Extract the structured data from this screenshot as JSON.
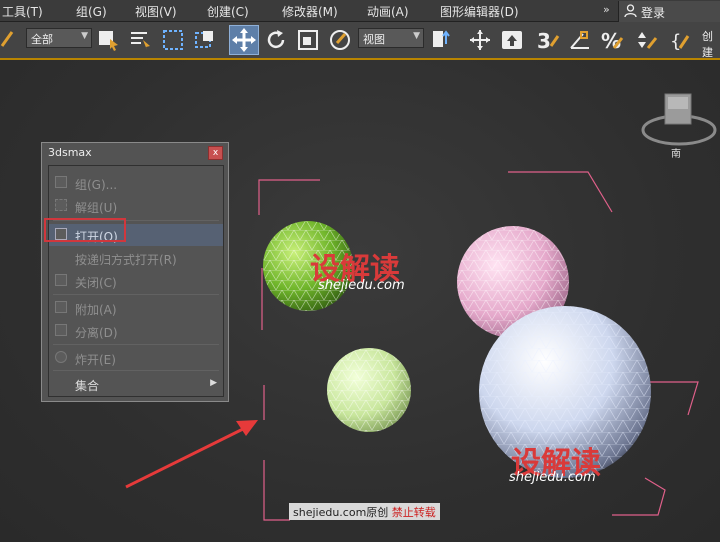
{
  "menubar": {
    "items": [
      "工具(T)",
      "组(G)",
      "视图(V)",
      "创建(C)",
      "修改器(M)",
      "动画(A)",
      "图形编辑器(D)"
    ],
    "more": "»",
    "login": "登录"
  },
  "toolbar": {
    "selection_filter": "全部",
    "reference_coord": "视图",
    "create_label": "创建"
  },
  "viewcube": {
    "south_label": "南"
  },
  "dialog": {
    "title": "3dsmax",
    "close": "x",
    "items": [
      {
        "label": "组(G)...",
        "enabled": false
      },
      {
        "label": "解组(U)",
        "enabled": false
      },
      {
        "label": "打开(O)",
        "enabled": true,
        "active": true
      },
      {
        "label": "按递归方式打开(R)",
        "enabled": false
      },
      {
        "label": "关闭(C)",
        "enabled": false
      },
      {
        "label": "附加(A)",
        "enabled": false
      },
      {
        "label": "分离(D)",
        "enabled": false
      },
      {
        "label": "炸开(E)",
        "enabled": false
      },
      {
        "label": "集合",
        "enabled": true,
        "submenu": true
      }
    ]
  },
  "watermarks": {
    "brand": "设解读",
    "url": "shejiedu.com",
    "footer_site": "shejiedu.com原创",
    "footer_warn": "禁止转载"
  },
  "colors": {
    "accent": "#b98500",
    "highlight": "#d0373d",
    "bracket": "#e0608a",
    "arrow": "#e63a3a"
  }
}
